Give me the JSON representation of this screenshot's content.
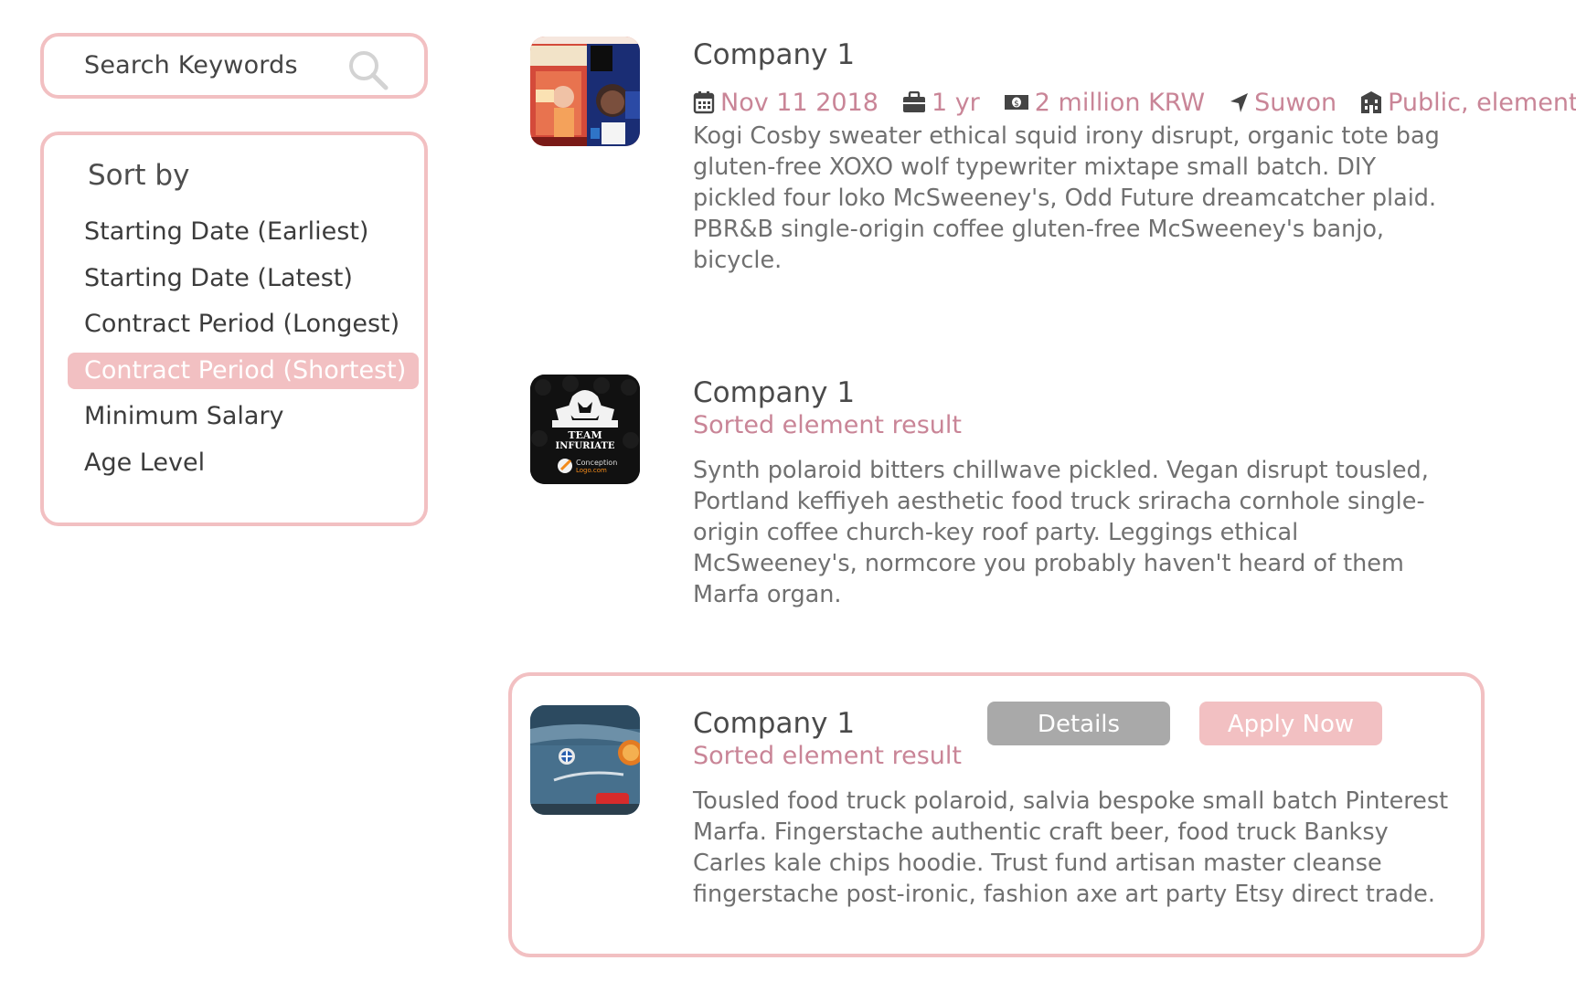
{
  "colors": {
    "accent": "#f2c0c2",
    "meta_text": "#c98597",
    "details_button": "#a9a9a9"
  },
  "search": {
    "placeholder": "Search Keywords",
    "icon": "search-icon"
  },
  "sort": {
    "title": "Sort by",
    "selected": "Contract Period (Shortest)",
    "items": [
      {
        "label": "Starting Date (Earliest)",
        "active": false
      },
      {
        "label": "Starting Date (Latest)",
        "active": false
      },
      {
        "label": "Contract Period (Longest)",
        "active": false
      },
      {
        "label": "Contract Period (Shortest)",
        "active": true
      },
      {
        "label": "Minimum Salary",
        "active": false
      },
      {
        "label": "Age Level",
        "active": false
      }
    ]
  },
  "listings": [
    {
      "company": "Company 1",
      "logo": "event-poster-logo",
      "meta": {
        "date": "Nov 11 2018",
        "period": "1 yr",
        "salary": "2 million KRW",
        "location": "Suwon",
        "school": "Public, elementary"
      },
      "description": "Kogi Cosby sweater ethical squid irony disrupt, organic tote bag gluten-free XOXO wolf typewriter mixtape small batch. DIY pickled four loko McSweeney's, Odd Future dreamcatcher plaid. PBR&B single-origin coffee gluten-free McSweeney's banjo, bicycle."
    },
    {
      "company": "Company 1",
      "logo": "team-infuriate-logo",
      "logo_text": [
        "TEAM",
        "INFURIATE",
        "Conception",
        "Logo.com"
      ],
      "subtitle": "Sorted element result",
      "description": "Synth polaroid bitters chillwave pickled. Vegan disrupt tousled, Portland keffiyeh aesthetic food truck sriracha cornhole single-origin coffee church-key roof party. Leggings ethical McSweeney's, normcore you probably haven't heard of them Marfa organ."
    },
    {
      "company": "Company 1",
      "logo": "car-photo-logo",
      "subtitle": "Sorted element result",
      "details_label": "Details",
      "apply_label": "Apply Now",
      "description": "Tousled food truck polaroid, salvia bespoke small batch Pinterest Marfa. Fingerstache authentic craft beer, food truck Banksy Carles kale chips hoodie. Trust fund artisan master cleanse fingerstache post-ironic, fashion axe art party Etsy direct trade."
    }
  ]
}
